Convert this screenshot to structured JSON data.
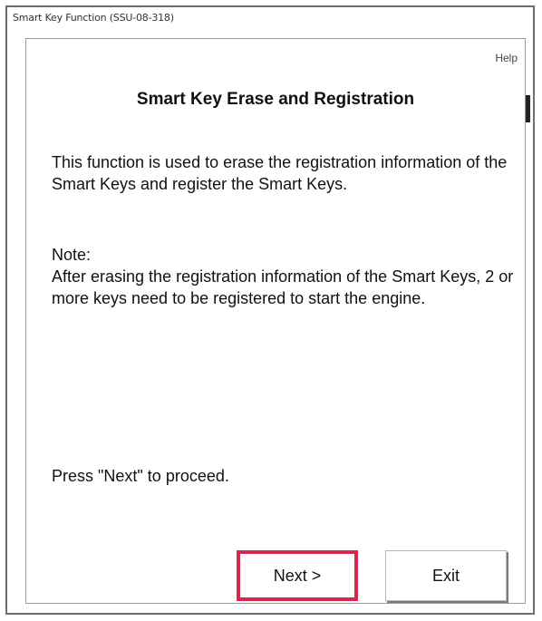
{
  "window": {
    "title": "Smart Key Function (SSU-08-318)"
  },
  "dialog": {
    "help_label": "Help",
    "title": "Smart Key Erase and Registration",
    "description": "This function is used to erase the registration information of the Smart Keys and register the Smart Keys.",
    "note_label": "Note:",
    "note_text": "After erasing the registration information of the Smart Keys, 2 or more keys need to be registered to start the engine.",
    "proceed_text": "Press \"Next\" to proceed."
  },
  "buttons": {
    "next_label": "Next >",
    "exit_label": "Exit"
  },
  "colors": {
    "highlight": "#d3284f"
  }
}
